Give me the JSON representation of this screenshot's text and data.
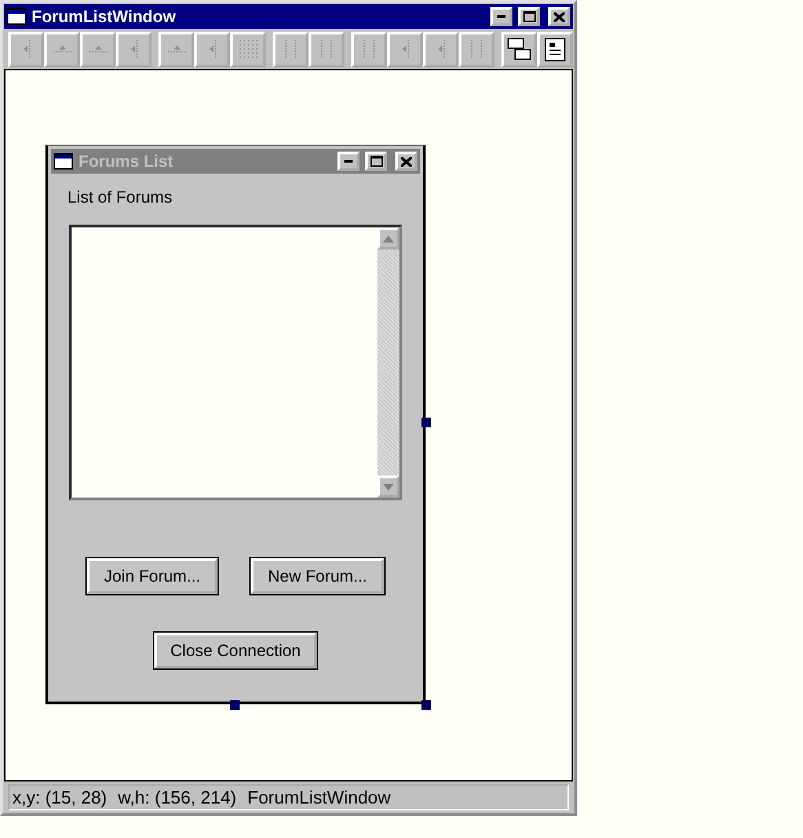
{
  "window": {
    "title": "ForumListWindow"
  },
  "form": {
    "title": "Forums List",
    "active": false,
    "label": "List of Forums",
    "buttons": [
      {
        "label": "Join Forum..."
      },
      {
        "label": "New Forum..."
      }
    ],
    "close_button": {
      "label": "Close Connection"
    }
  },
  "status_bar": {
    "position": "x,y: (15, 28)",
    "size": "w,h: (156, 214)",
    "name": "ForumListWindow"
  }
}
